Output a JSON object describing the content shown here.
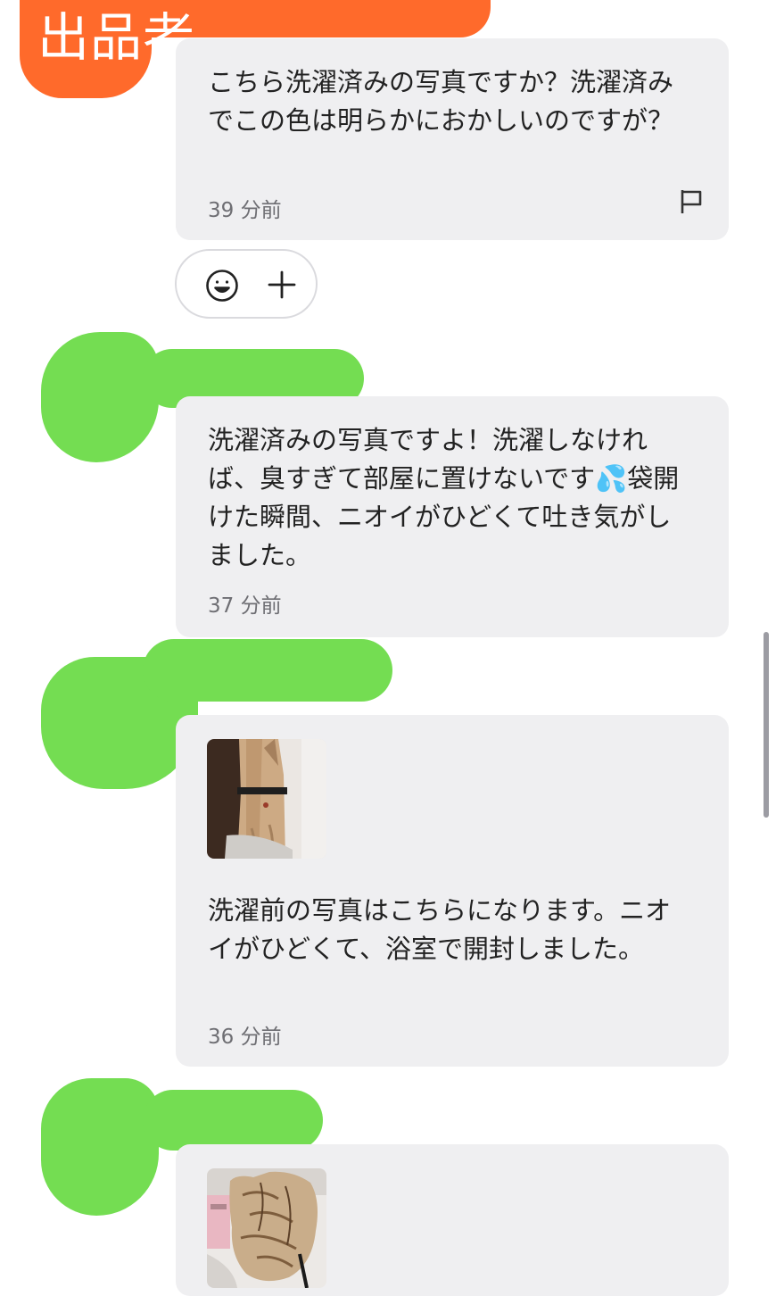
{
  "seller": {
    "label": "出品者"
  },
  "messages": [
    {
      "text": "こちら洗濯済みの写真ですか？洗濯済みでこの色は明らかにおかしいのですが？",
      "time": "39 分前",
      "report_icon": "flag-icon"
    },
    {
      "text": "洗濯済みの写真ですよ！洗濯しなければ、臭すぎて部屋に置けないです💦袋開けた瞬間、ニオイがひどくて吐き気がしました。",
      "time": "37 分前"
    },
    {
      "image": "clothing-photo-hanging-dress",
      "text": "洗濯前の写真はこちらになります。ニオイがひどくて、浴室で開封しました。",
      "time": "36 分前"
    },
    {
      "image": "clothing-photo-bundled-garment"
    }
  ],
  "reactions": {
    "emoji_icon": "smiley-icon",
    "add_icon": "plus-icon"
  },
  "colors": {
    "seller_banner": "#ff6a2b",
    "redaction": "#74dd52",
    "bubble": "#efeff1",
    "timestamp": "#6e6e73"
  }
}
